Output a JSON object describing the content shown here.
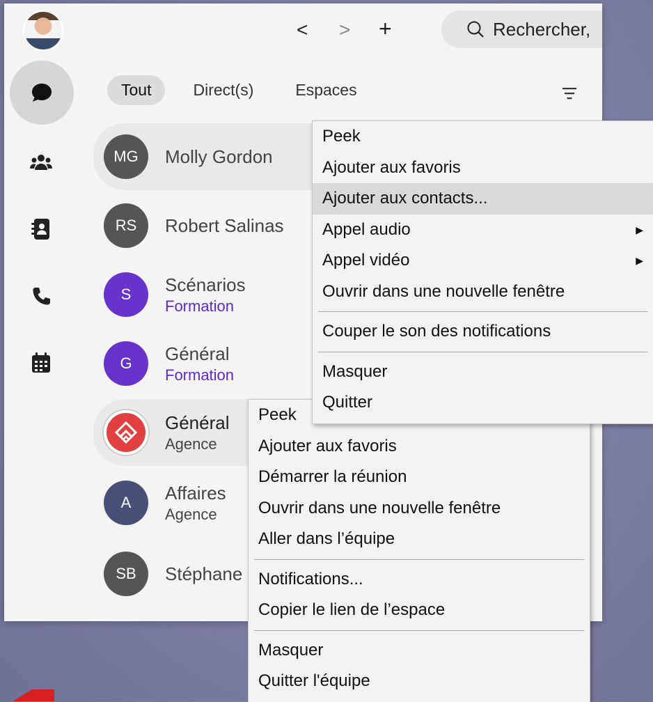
{
  "header": {
    "search_placeholder": "Rechercher,",
    "nav_back": "<",
    "nav_forward": ">",
    "nav_add": "+"
  },
  "tabs": [
    {
      "label": "Tout",
      "active": true
    },
    {
      "label": "Direct(s)",
      "active": false
    },
    {
      "label": "Espaces",
      "active": false
    }
  ],
  "conversations": [
    {
      "initials": "MG",
      "name": "Molly Gordon",
      "sub": ""
    },
    {
      "initials": "RS",
      "name": "Robert Salinas",
      "sub": ""
    },
    {
      "initials": "S",
      "name": "Scénarios",
      "sub": "Formation"
    },
    {
      "initials": "G",
      "name": "Général",
      "sub": "Formation"
    },
    {
      "initials": "",
      "name": "Général",
      "sub": "Agence"
    },
    {
      "initials": "A",
      "name": "Affaires",
      "sub": "Agence"
    },
    {
      "initials": "SB",
      "name": "Stéphane",
      "sub": ""
    }
  ],
  "menu_person": {
    "items": [
      "Peek",
      "Ajouter aux favoris",
      "Ajouter aux contacts...",
      "Appel audio",
      "Appel vidéo",
      "Ouvrir dans une nouvelle fenêtre",
      "Couper le son des notifications",
      "Masquer",
      "Quitter"
    ],
    "highlighted": "Ajouter aux contacts..."
  },
  "menu_space": {
    "items": [
      "Peek",
      "Ajouter aux favoris",
      "Démarrer la réunion",
      "Ouvrir dans une nouvelle fenêtre",
      "Aller dans l’équipe",
      "Notifications...",
      "Copier le lien de l’espace",
      "Masquer",
      "Quitter l'équipe"
    ]
  },
  "colors": {
    "accent_purple": "#6633cc",
    "subtitle_purple": "#5b2bd1",
    "avatar_gray": "#555555",
    "background": "#8d8fb0"
  },
  "icons": [
    "chat-icon",
    "team-icon",
    "contacts-icon",
    "phone-icon",
    "calendar-icon",
    "search-icon",
    "filter-icon",
    "submenu-arrow-icon"
  ]
}
